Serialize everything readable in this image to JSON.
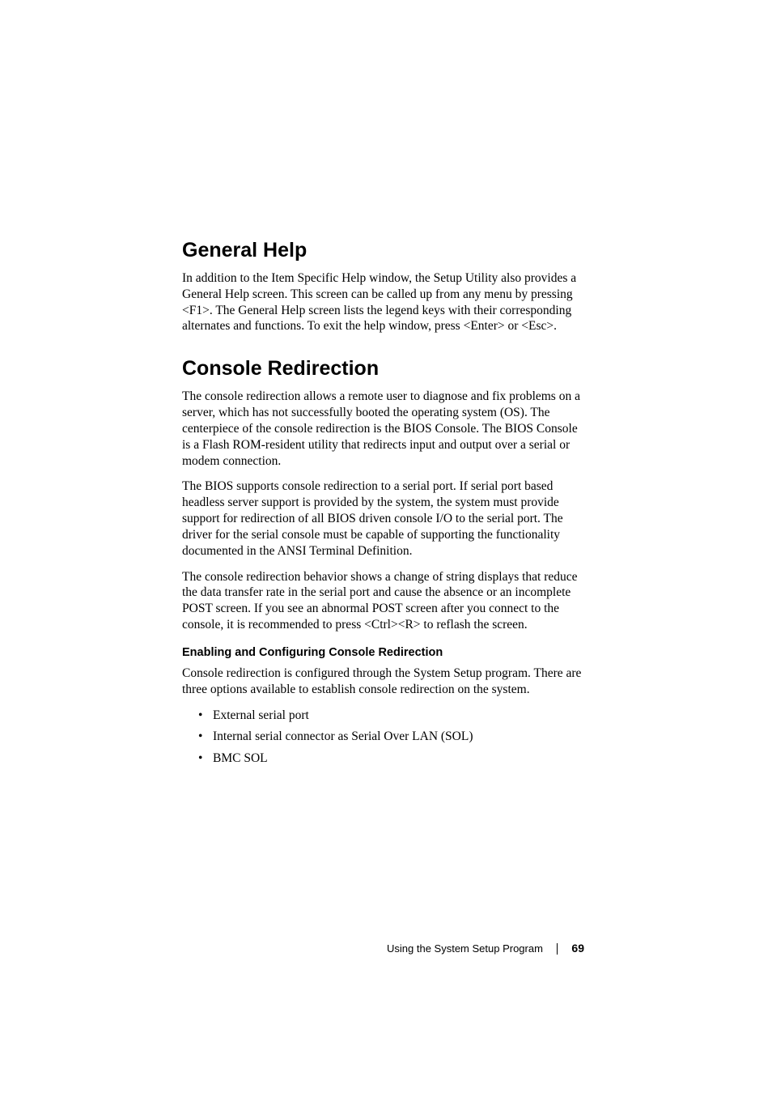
{
  "section1": {
    "heading": "General Help",
    "p1": "In addition to the Item Specific Help window, the Setup Utility also provides a General Help screen. This screen can be called up from any menu by pressing <F1>. The General Help screen lists the legend keys with their corresponding alternates and functions. To exit the help window, press <Enter> or <Esc>."
  },
  "section2": {
    "heading": "Console Redirection",
    "p1": "The console redirection allows a remote user to diagnose and fix problems on a server, which has not successfully booted the operating system (OS). The centerpiece of the console redirection is the BIOS Console. The BIOS Console is a Flash ROM-resident utility that redirects input and output over a serial or modem connection.",
    "p2": "The BIOS supports console redirection to a serial port. If serial port based headless server support is provided by the system, the system must provide support for redirection of all BIOS driven console I/O to the serial port. The driver for the serial console must be capable of supporting the functionality documented in the ANSI Terminal Definition.",
    "p3": "The console redirection behavior shows a change of string displays that reduce the data transfer rate in the serial port and cause the absence or an incomplete POST screen. If you see an abnormal POST screen after you connect to the console, it is recommended to press <Ctrl><R> to reflash the screen.",
    "sub": {
      "heading": "Enabling and Configuring Console Redirection",
      "p1": "Console redirection is configured through the System Setup program. There are three options available to establish console redirection on the system.",
      "items": [
        "External serial port",
        "Internal serial connector as Serial Over LAN (SOL)",
        "BMC SOL"
      ]
    }
  },
  "footer": {
    "label": "Using the System Setup Program",
    "page": "69"
  }
}
